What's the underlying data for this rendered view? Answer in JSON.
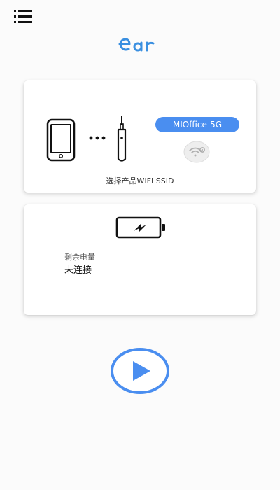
{
  "app": {
    "logo_text": "ear"
  },
  "header": {
    "menu_icon": "list-menu-icon"
  },
  "wifi_card": {
    "ssid": "MIOffice-5G",
    "caption": "选择产品WIFI SSID",
    "icons": [
      "phone-icon",
      "ellipsis-icon",
      "earpick-device-icon",
      "wifi-settings-icon"
    ]
  },
  "battery_card": {
    "label": "剩余电量",
    "status": "未连接",
    "icon": "battery-charging-icon"
  },
  "controls": {
    "play_icon": "play-icon"
  },
  "colors": {
    "accent": "#4a8ef0",
    "logo": "#3a8fe0",
    "background": "#fbfbfb",
    "card": "#ffffff"
  }
}
